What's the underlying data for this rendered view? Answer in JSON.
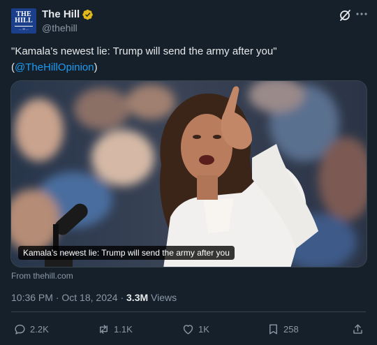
{
  "account": {
    "display_name": "The Hill",
    "handle": "@thehill",
    "avatar_logo_line1": "THE",
    "avatar_logo_line2": "HILL",
    "avatar_logo_sub": "— 30 —",
    "verified_color": "#e2b719"
  },
  "tweet": {
    "text_before": "\"Kamala’s newest lie: Trump will send the army after you\" (",
    "mention": "@TheHillOpinion",
    "text_after": ")"
  },
  "media": {
    "caption": "Kamala’s newest lie: Trump will send the army after you",
    "source": "From thehill.com"
  },
  "meta": {
    "time": "10:36 PM",
    "separator": " · ",
    "date": "Oct 18, 2024",
    "views_count": "3.3M",
    "views_label": " Views"
  },
  "actions": {
    "replies": "2.2K",
    "reposts": "1.1K",
    "likes": "1K",
    "bookmarks": "258"
  },
  "icons": [
    "verified-badge-icon",
    "grok-icon",
    "more-icon",
    "reply-icon",
    "repost-icon",
    "like-icon",
    "bookmark-icon",
    "share-icon"
  ],
  "colors": {
    "background": "#15202b",
    "text": "#e7e9ea",
    "secondary": "#8b98a5",
    "link": "#1d9bf0",
    "border": "#38444d"
  }
}
